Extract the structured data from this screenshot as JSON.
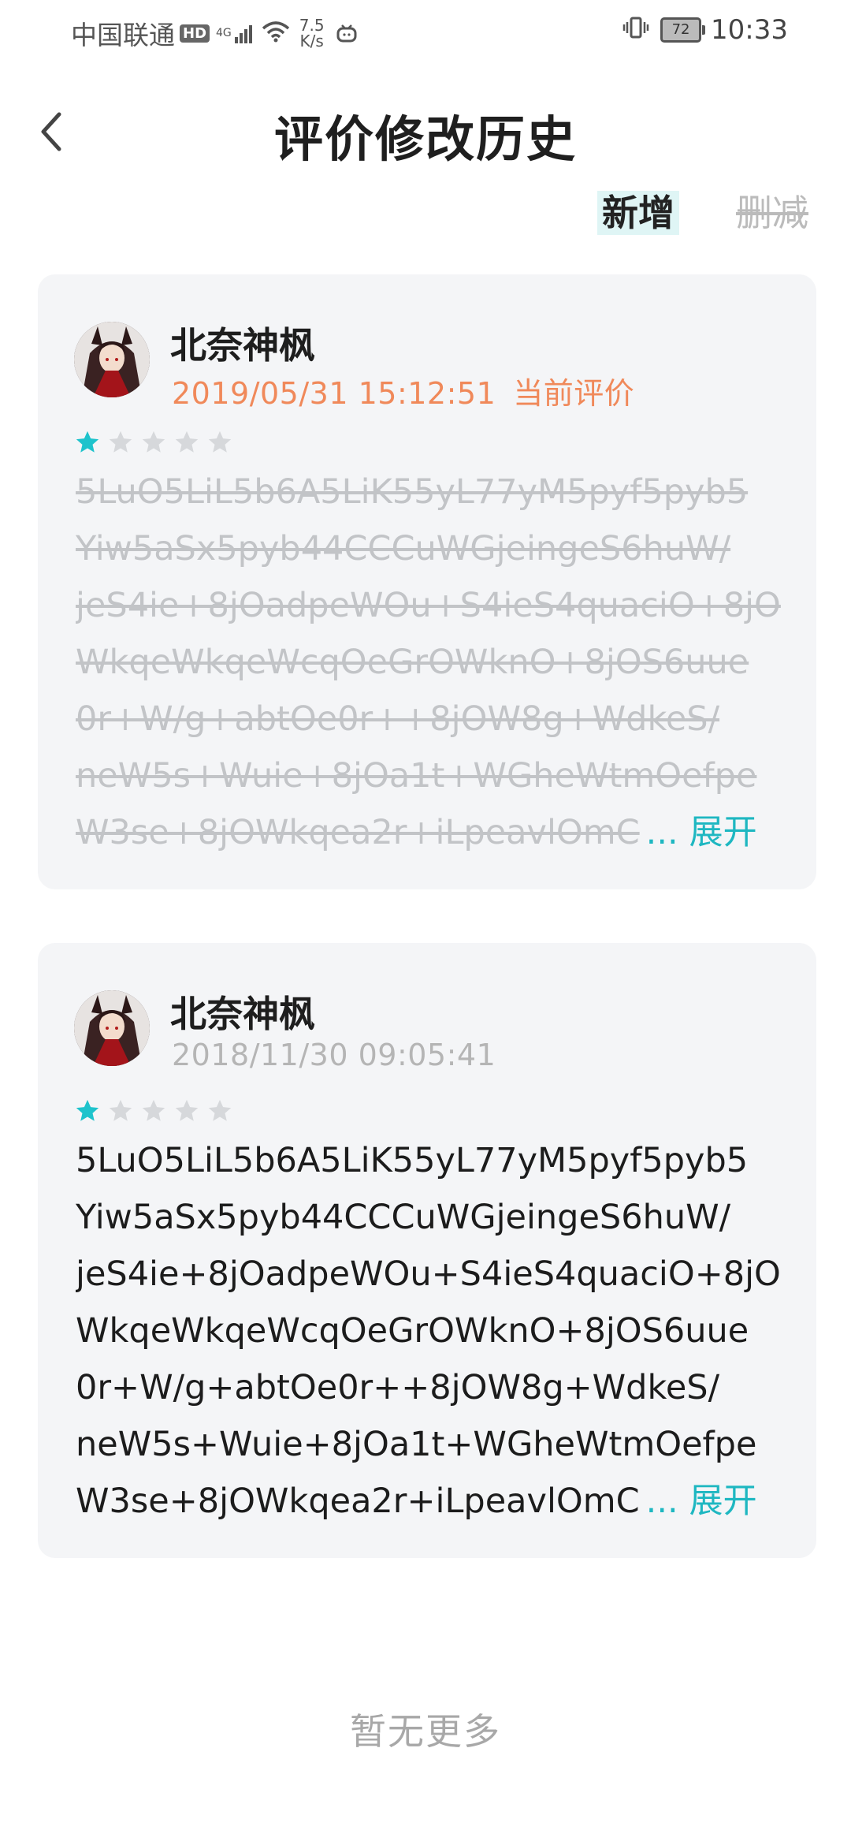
{
  "status_bar": {
    "carrier": "中国联通",
    "hd": "HD",
    "network": "4G",
    "speed_value": "7.5",
    "speed_unit": "K/s",
    "battery": "72",
    "time": "10:33"
  },
  "header": {
    "back_icon": "chevron-left-icon",
    "title": "评价修改历史"
  },
  "legend": {
    "add_label": "新增",
    "delete_label": "删减"
  },
  "reviews": [
    {
      "username": "北奈神枫",
      "timestamp": "2019/05/31 15:12:51",
      "current_label": "当前评价",
      "rating": 1,
      "max_rating": 5,
      "lines": [
        "5LuO5LiL5b6A5LiK55yL77yM5pyf5pyb5",
        "Yiw5aSx5pyb44CCCuWGjeingeS6huW/",
        "jeS4ie+8jOadpeWOu+S4ieS4quaciO+8jO",
        "WkqeWkqeWcqOeGrOWknO+8jOS6uue",
        "0r+W/g+abtOe0r++8jOW8g+WdkeS/",
        "neW5s+Wuie+8jOa1t+WGheWtmOefpe",
        "W3se+8jOWkqea2r+iLpeavlOmC"
      ],
      "ellipsis": "...",
      "expand_label": "展开",
      "status": "deleted"
    },
    {
      "username": "北奈神枫",
      "timestamp": "2018/11/30 09:05:41",
      "current_label": "",
      "rating": 1,
      "max_rating": 5,
      "lines": [
        "5LuO5LiL5b6A5LiK55yL77yM5pyf5pyb5",
        "Yiw5aSx5pyb44CCCuWGjeingeS6huW/",
        "jeS4ie+8jOadpeWOu+S4ieS4quaciO+8jO",
        "WkqeWkqeWcqOeGrOWknO+8jOS6uue",
        "0r+W/g+abtOe0r++8jOW8g+WdkeS/",
        "neW5s+Wuie+8jOa1t+WGheWtmOefpe",
        "W3se+8jOWkqea2r+iLpeavlOmC"
      ],
      "ellipsis": "...",
      "expand_label": "展开",
      "status": "added"
    }
  ],
  "footer": {
    "no_more": "暂无更多"
  },
  "colors": {
    "accent": "#1eb7c1",
    "current": "#f0895a",
    "star_on": "#1ec3cc",
    "star_off": "#d6d8db"
  }
}
